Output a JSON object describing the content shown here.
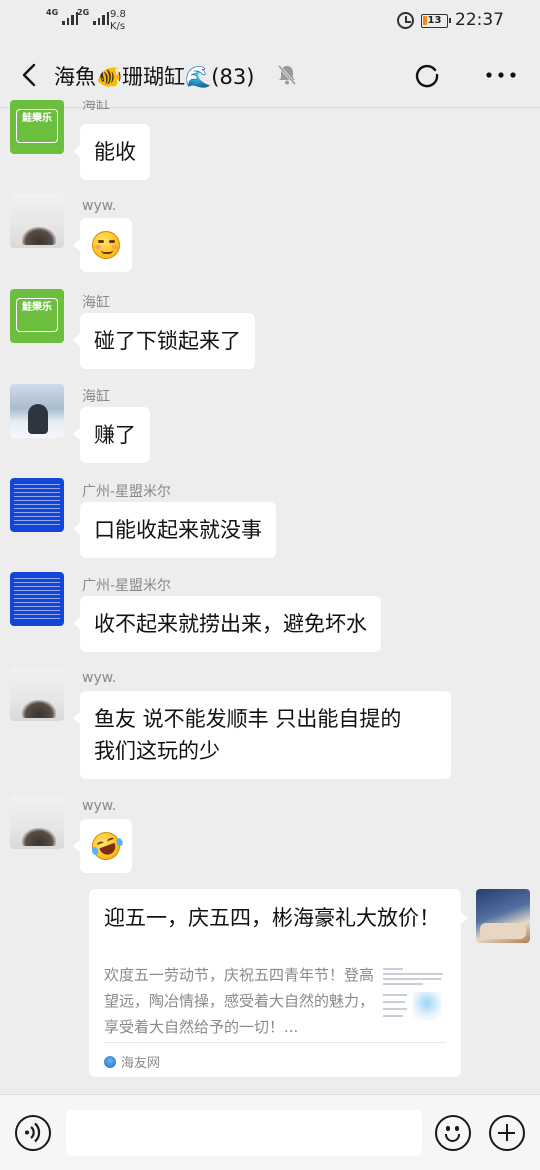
{
  "status_bar": {
    "sim1": "4G",
    "sim2": "2G",
    "net_speed_value": "9.8",
    "net_speed_unit": "K/s",
    "battery_level": "13",
    "time": "22:37"
  },
  "header": {
    "title": "海魚🐠珊瑚缸🌊(83)"
  },
  "messages": [
    {
      "sender": "海缸",
      "text": "能收"
    },
    {
      "sender": "wyw.",
      "emoji": "smirk"
    },
    {
      "sender": "海缸",
      "text": "碰了下锁起来了"
    },
    {
      "sender": "海缸",
      "text": "赚了"
    },
    {
      "sender": "广州-星盟米尔",
      "text": "口能收起来就没事"
    },
    {
      "sender": "广州-星盟米尔",
      "text": "收不起来就捞出来，避免坏水"
    },
    {
      "sender": "wyw.",
      "text_line1": "鱼友 说不能发顺丰 只出能自提的",
      "text_line2": "我们这玩的少"
    },
    {
      "sender": "wyw.",
      "emoji": "rolling-laughing"
    }
  ],
  "avatar_logo_text": "鮭樂乐",
  "link_card": {
    "title": "迎五一，庆五四，彬海豪礼大放价！",
    "description": "欢度五一劳动节，庆祝五四青年节！登高望远，陶冶情操，感受着大自然的魅力，享受着大自然给予的一切！...",
    "source": "海友网"
  },
  "input": {
    "placeholder": ""
  },
  "colors": {
    "background": "#ededed",
    "bubble": "#ffffff",
    "battery_low": "#f08c1b"
  }
}
